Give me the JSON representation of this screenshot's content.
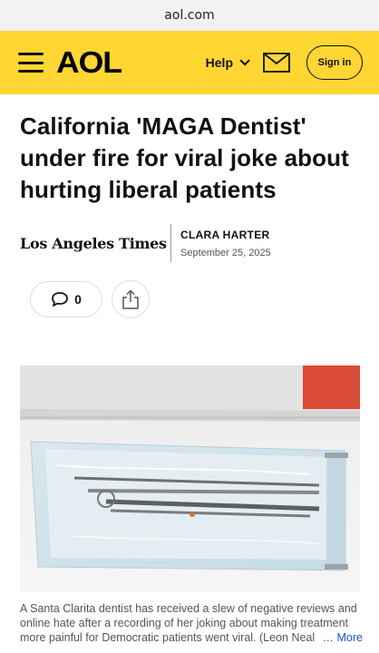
{
  "browser": {
    "url": "aol.com"
  },
  "header": {
    "logo": "AOL",
    "help_label": "Help",
    "signin_label": "Sign in"
  },
  "article": {
    "headline": "California 'MAGA Dentist' under fire for viral joke about hurting liberal patients",
    "source": "Los Angeles Times",
    "author": "CLARA HARTER",
    "date": "September 25, 2025",
    "comment_count": "0",
    "caption": "A Santa Clarita dentist has received a slew of negative reviews and online hate after a recording of her joking about making treatment more painful for Democratic patients went viral. (Leon Neal",
    "more_label": "More"
  },
  "colors": {
    "header_bg": "#ffd632",
    "link": "#1a55c8"
  },
  "icons": [
    "hamburger-icon",
    "chevron-down-icon",
    "mail-icon",
    "comment-icon",
    "share-icon"
  ]
}
